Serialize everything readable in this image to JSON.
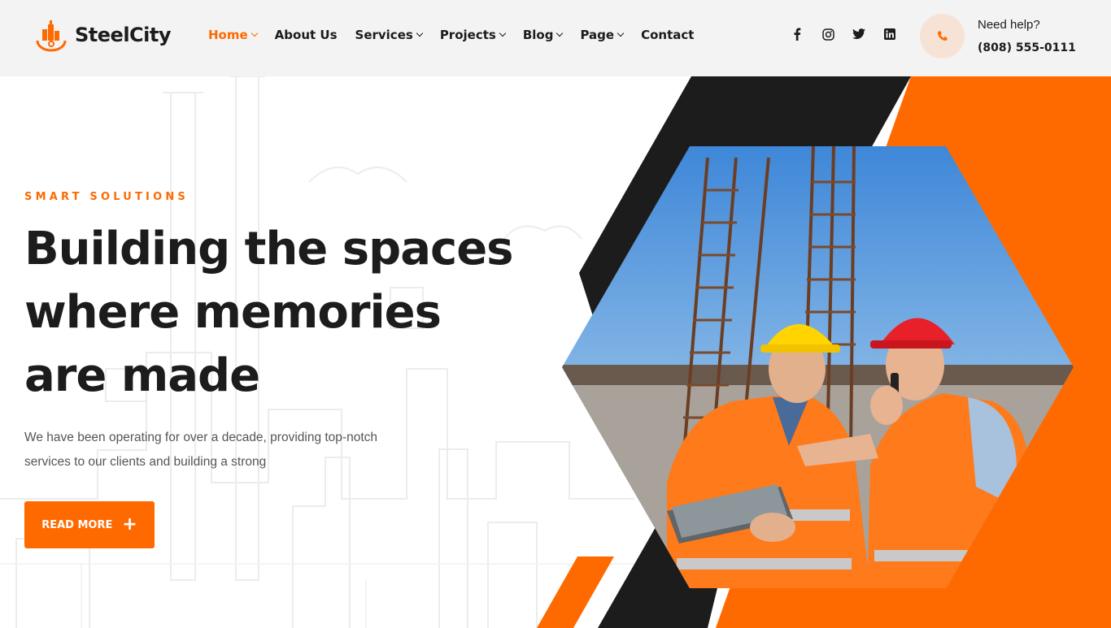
{
  "brand": {
    "name": "SteelCity"
  },
  "nav": {
    "items": [
      {
        "label": "Home",
        "dropdown": true,
        "active": true
      },
      {
        "label": "About Us",
        "dropdown": false,
        "active": false
      },
      {
        "label": "Services",
        "dropdown": true,
        "active": false
      },
      {
        "label": "Projects",
        "dropdown": true,
        "active": false
      },
      {
        "label": "Blog",
        "dropdown": true,
        "active": false
      },
      {
        "label": "Page",
        "dropdown": true,
        "active": false
      },
      {
        "label": "Contact",
        "dropdown": false,
        "active": false
      }
    ]
  },
  "socials": [
    "facebook-icon",
    "instagram-icon",
    "twitter-icon",
    "linkedin-icon"
  ],
  "help": {
    "label": "Need help?",
    "phone": "(808) 555-0111"
  },
  "hero": {
    "eyebrow": "SMART SOLUTIONS",
    "headline": [
      "Building the spaces",
      "where memories",
      "are made"
    ],
    "description": [
      "We have been operating for over a decade, providing top-notch",
      "services to our clients and building a strong"
    ],
    "cta_label": "READ MORE"
  },
  "colors": {
    "accent": "#ff6a00",
    "dark": "#1c1c1c",
    "header_bg": "#f3f3f3"
  }
}
